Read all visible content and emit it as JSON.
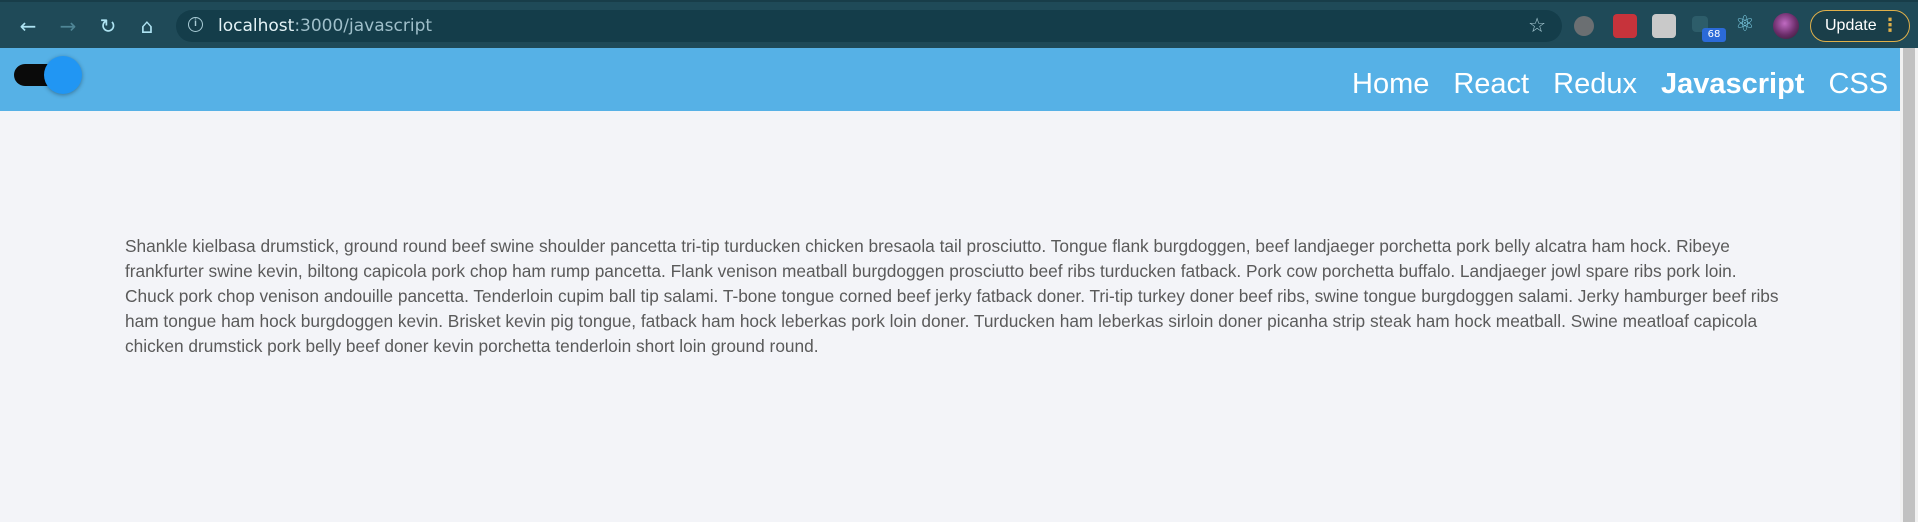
{
  "browser": {
    "url_host": "localhost",
    "url_path": ":3000/javascript",
    "update_label": "Update",
    "extension_badge": "68"
  },
  "site": {
    "nav": [
      {
        "label": "Home",
        "active": false
      },
      {
        "label": "React",
        "active": false
      },
      {
        "label": "Redux",
        "active": false
      },
      {
        "label": "Javascript",
        "active": true
      },
      {
        "label": "CSS",
        "active": false
      }
    ],
    "theme_toggle_on": true
  },
  "main": {
    "paragraph": "Shankle kielbasa drumstick, ground round beef swine shoulder pancetta tri-tip turducken chicken bresaola tail prosciutto. Tongue flank burgdoggen, beef landjaeger porchetta pork belly alcatra ham hock. Ribeye frankfurter swine kevin, biltong capicola pork chop ham rump pancetta. Flank venison meatball burgdoggen prosciutto beef ribs turducken fatback. Pork cow porchetta buffalo. Landjaeger jowl spare ribs pork loin. Chuck pork chop venison andouille pancetta. Tenderloin cupim ball tip salami. T-bone tongue corned beef jerky fatback doner. Tri-tip turkey doner beef ribs, swine tongue burgdoggen salami. Jerky hamburger beef ribs ham tongue ham hock burgdoggen kevin. Brisket kevin pig tongue, fatback ham hock leberkas pork loin doner. Turducken ham leberkas sirloin doner picanha strip steak ham hock meatball. Swine meatloaf capicola chicken drumstick pork belly beef doner kevin porchetta tenderloin short loin ground round."
  }
}
